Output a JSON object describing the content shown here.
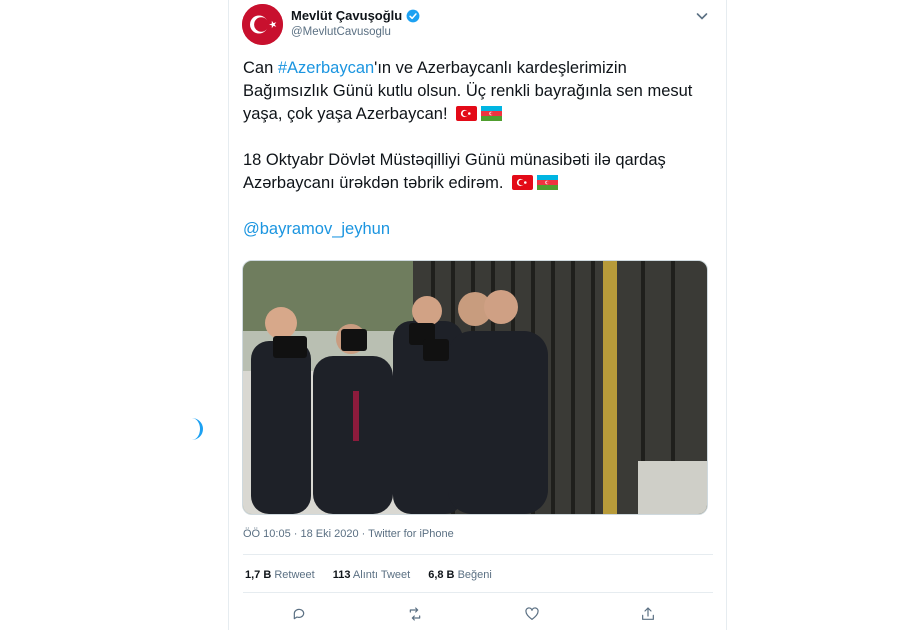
{
  "user": {
    "name": "Mevlüt Çavuşoğlu",
    "handle": "@MevlutCavusoglu"
  },
  "tweet": {
    "para1_prefix": "Can ",
    "para1_hashtag": "#Azerbaycan",
    "para1_rest": "'ın ve Azerbaycanlı kardeşlerimizin Bağımsızlık Günü kutlu olsun. Üç renkli bayrağınla sen mesut yaşa, çok yaşa Azerbaycan!",
    "para2": "18 Oktyabr Dövlət Müstəqilliyi Günü münasibəti ilə qardaş Azərbaycanı ürəkdən təbrik edirəm.",
    "mention": "@bayramov_jeyhun"
  },
  "meta": "ÖÖ 10:05 · 18 Eki 2020 · Twitter for iPhone",
  "stats": [
    {
      "count": "1,7 B",
      "label": "Retweet"
    },
    {
      "count": "113",
      "label": "Alıntı Tweet"
    },
    {
      "count": "6,8 B",
      "label": "Beğeni"
    }
  ],
  "colors": {
    "link": "#1b95e0",
    "verified": "#1da1f2",
    "turkey_red": "#e30a17"
  },
  "icons": [
    "verified-icon",
    "chevron-down-icon",
    "reply-icon",
    "retweet-icon",
    "like-icon",
    "share-icon",
    "turkey-flag-icon",
    "azerbaijan-flag-icon"
  ]
}
